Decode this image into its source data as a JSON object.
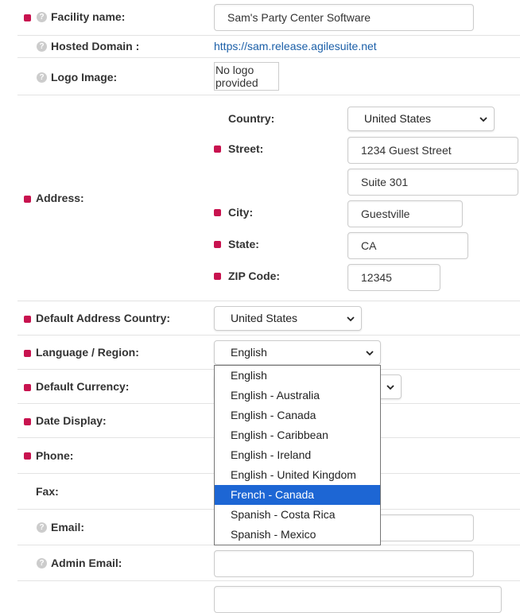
{
  "facility": {
    "label": "Facility name:",
    "value": "Sam's Party Center Software"
  },
  "hosted_domain": {
    "label": "Hosted Domain :",
    "value": "https://sam.release.agilesuite.net"
  },
  "logo": {
    "label": "Logo Image:",
    "value": "No logo provided"
  },
  "address": {
    "label": "Address:",
    "country_label": "Country:",
    "country_value": "United States",
    "street_label": "Street:",
    "street1": "1234 Guest Street",
    "street2": "Suite 301",
    "city_label": "City:",
    "city_value": "Guestville",
    "state_label": "State:",
    "state_value": "CA",
    "zip_label": "ZIP Code:",
    "zip_value": "12345"
  },
  "default_country": {
    "label": "Default Address Country:",
    "value": "United States"
  },
  "language": {
    "label": "Language / Region:",
    "value": "English",
    "options": [
      "English",
      "English - Australia",
      "English - Canada",
      "English - Caribbean",
      "English - Ireland",
      "English - United Kingdom",
      "French - Canada",
      "Spanish - Costa Rica",
      "Spanish - Mexico"
    ],
    "highlighted": "French - Canada"
  },
  "currency": {
    "label": "Default Currency:"
  },
  "date_display": {
    "label": "Date Display:"
  },
  "phone": {
    "label": "Phone:"
  },
  "fax": {
    "label": "Fax:"
  },
  "email": {
    "label": "Email:"
  },
  "admin_email": {
    "label": "Admin Email:"
  },
  "colors": {
    "required": "#c8134f",
    "link": "#1b5fa8",
    "highlight": "#1d66d4"
  },
  "icons": {
    "help": "question-circle-icon",
    "chevron": "chevron-down-icon"
  }
}
